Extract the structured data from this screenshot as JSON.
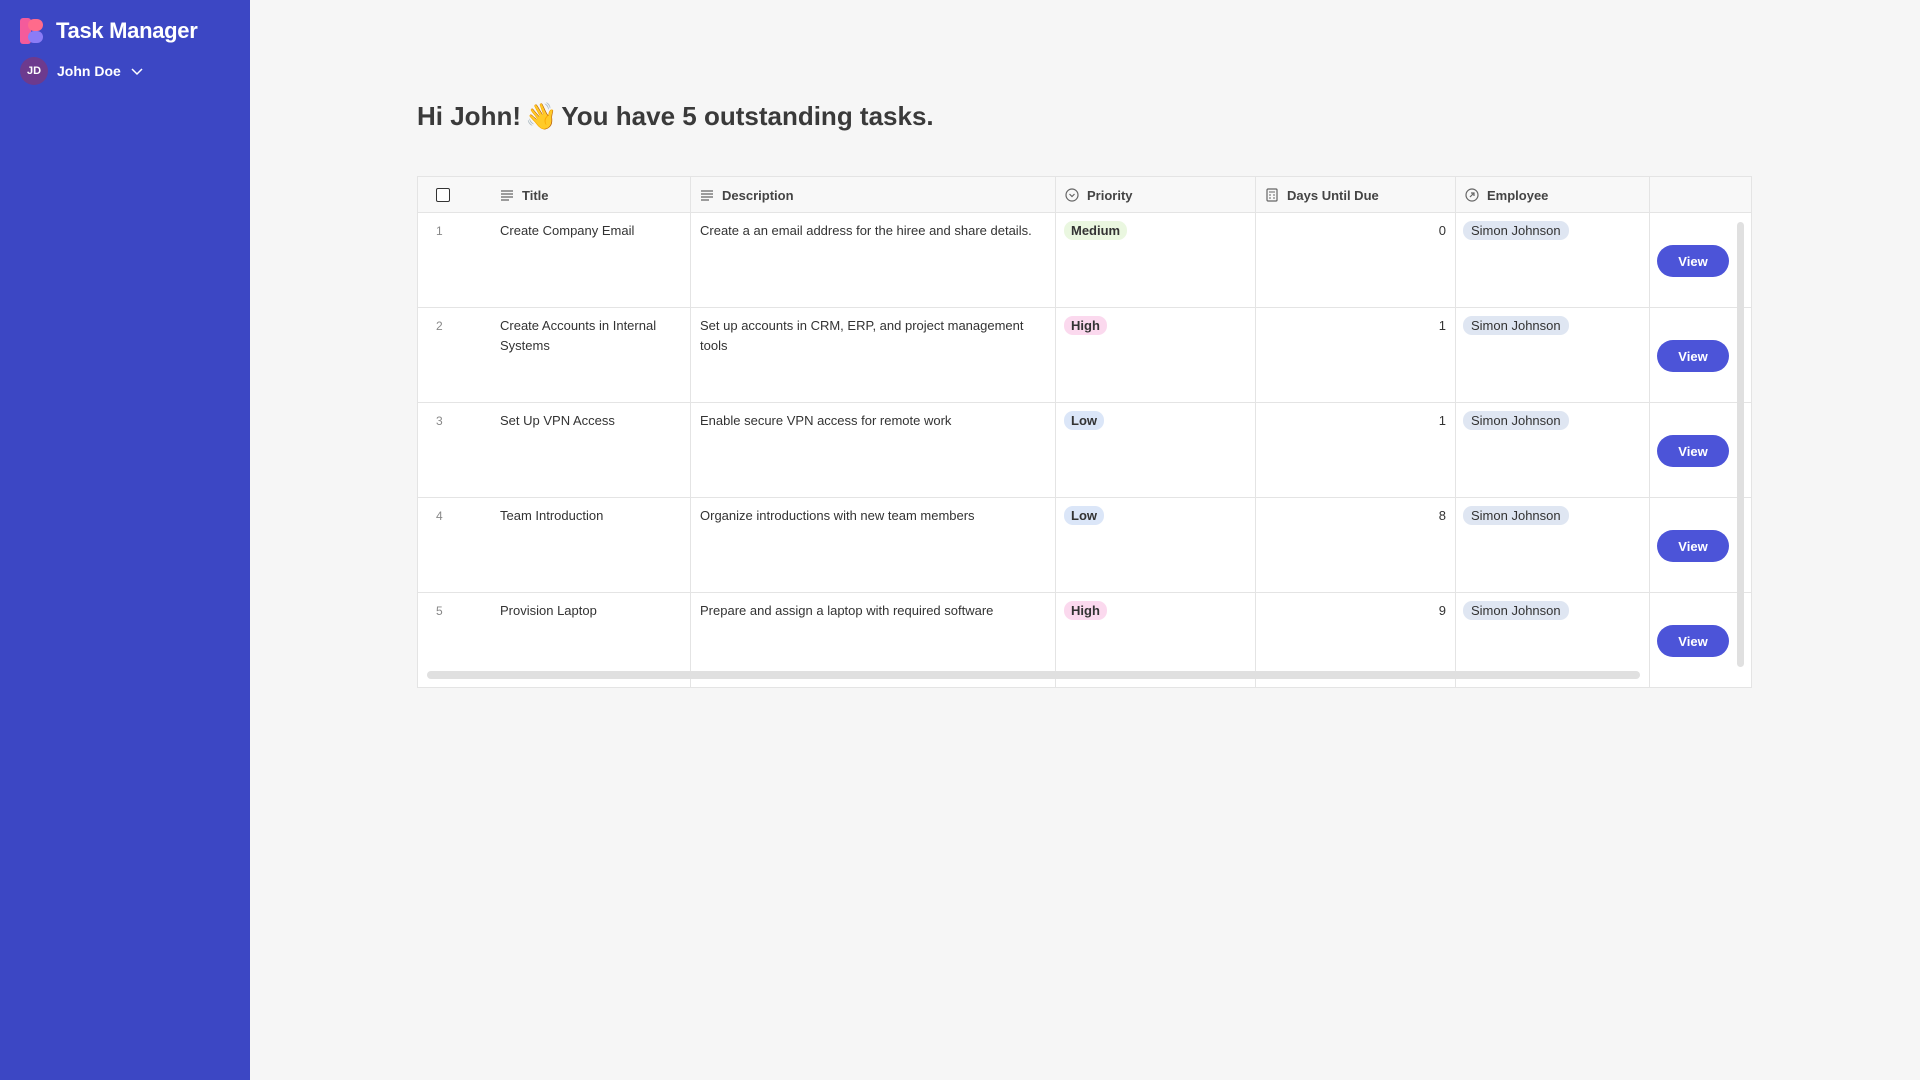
{
  "app": {
    "title": "Task Manager"
  },
  "user": {
    "initials": "JD",
    "name": "John Doe"
  },
  "greeting": {
    "hi": "Hi John!",
    "emoji": "👋",
    "message": "You have 5 outstanding tasks."
  },
  "table": {
    "columns": {
      "title": "Title",
      "description": "Description",
      "priority": "Priority",
      "days": "Days Until Due",
      "employee": "Employee"
    },
    "view_label": "View",
    "rows": [
      {
        "index": "1",
        "title": "Create Company Email",
        "description": "Create a an email address for the hiree and share details.",
        "priority": "Medium",
        "days": "0",
        "employee": "Simon Johnson"
      },
      {
        "index": "2",
        "title": "Create Accounts in Internal Systems",
        "description": "Set up accounts in CRM, ERP, and project management tools",
        "priority": "High",
        "days": "1",
        "employee": "Simon Johnson"
      },
      {
        "index": "3",
        "title": "Set Up VPN Access",
        "description": "Enable secure VPN access for remote work",
        "priority": "Low",
        "days": "1",
        "employee": "Simon Johnson"
      },
      {
        "index": "4",
        "title": "Team Introduction",
        "description": "Organize introductions with new team members",
        "priority": "Low",
        "days": "8",
        "employee": "Simon Johnson"
      },
      {
        "index": "5",
        "title": "Provision Laptop",
        "description": "Prepare and assign a laptop with required software",
        "priority": "High",
        "days": "9",
        "employee": "Simon Johnson"
      }
    ]
  }
}
